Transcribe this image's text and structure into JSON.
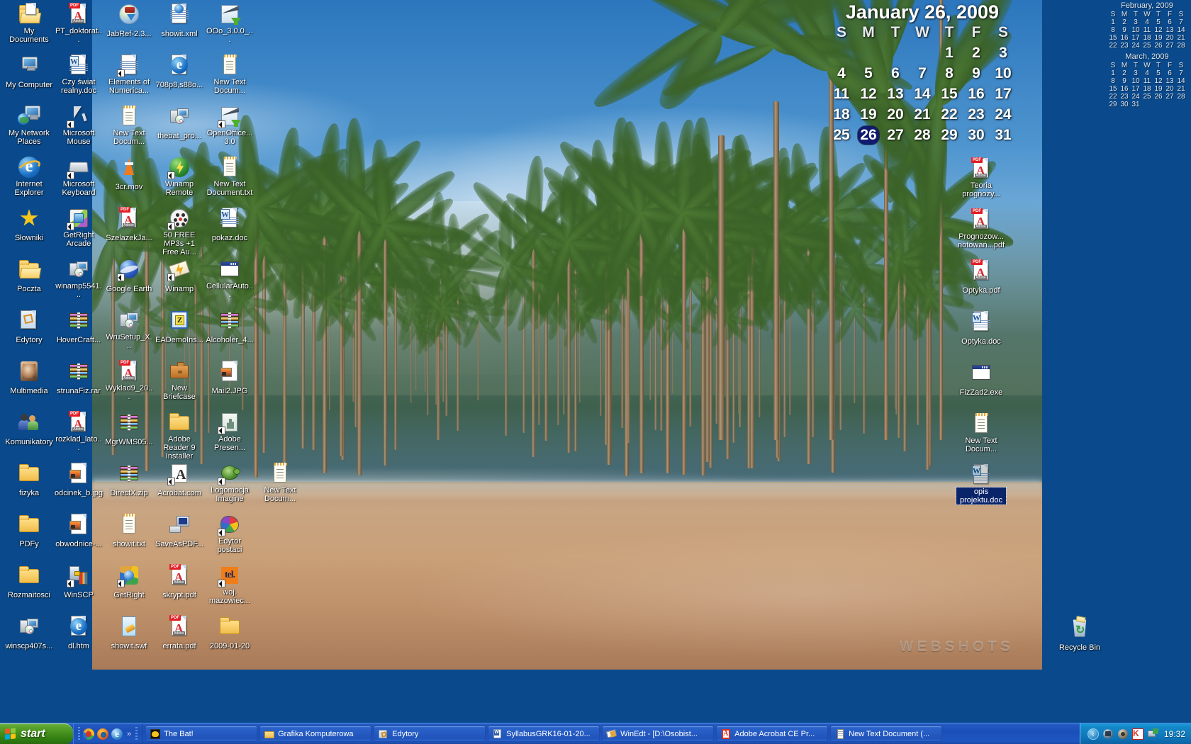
{
  "desktop": {
    "background_color": "#0A4A8C",
    "watermark": "WEBSHOTS",
    "icons_left": [
      {
        "label": "My Documents",
        "art": "mydocs",
        "shortcut": false
      },
      {
        "label": "My Computer",
        "art": "mycomputer",
        "shortcut": false
      },
      {
        "label": "My Network Places",
        "art": "network",
        "shortcut": false
      },
      {
        "label": "Internet Explorer",
        "art": "ie",
        "shortcut": false
      },
      {
        "label": "Słowniki",
        "art": "star",
        "shortcut": false
      },
      {
        "label": "Poczta",
        "art": "folder-open",
        "shortcut": false
      },
      {
        "label": "Edytory",
        "art": "edytory",
        "shortcut": false
      },
      {
        "label": "Multimedia",
        "art": "face",
        "shortcut": false
      },
      {
        "label": "Komunikatory",
        "art": "people",
        "shortcut": false
      },
      {
        "label": "fizyka",
        "art": "folder",
        "shortcut": false
      },
      {
        "label": "PDFy",
        "art": "folder",
        "shortcut": false
      },
      {
        "label": "Rozmaitosci",
        "art": "folder",
        "shortcut": false
      },
      {
        "label": "winscp407s...",
        "art": "camera-cd",
        "shortcut": false
      }
    ],
    "icons_col2": [
      {
        "label": "PT_doktorat...",
        "art": "pdf",
        "shortcut": false
      },
      {
        "label": "Czy świat realny.doc",
        "art": "word",
        "shortcut": false
      },
      {
        "label": "Microsoft Mouse",
        "art": "mouse",
        "shortcut": true
      },
      {
        "label": "Microsoft Keyboard",
        "art": "keyboard",
        "shortcut": true
      },
      {
        "label": "GetRight Arcade",
        "art": "dice",
        "shortcut": true
      },
      {
        "label": "winamp5541...",
        "art": "camera-cd",
        "shortcut": false
      },
      {
        "label": "HoverCraft...",
        "art": "rar",
        "shortcut": false
      },
      {
        "label": "strunaFiz.rar",
        "art": "rar",
        "shortcut": false
      },
      {
        "label": "rozklad_lato...",
        "art": "pdf",
        "shortcut": false
      },
      {
        "label": "odcinek_b.jpg",
        "art": "image",
        "shortcut": false
      },
      {
        "label": "obwodnice-...",
        "art": "image",
        "shortcut": false
      },
      {
        "label": "WinSCP",
        "art": "winscp",
        "shortcut": true
      },
      {
        "label": "dl.htm",
        "art": "ie-doc",
        "shortcut": false
      }
    ],
    "icons_col3": [
      {
        "label": "JabRef-2.3...",
        "art": "jabref",
        "shortcut": false
      },
      {
        "label": "Elements of Numerica...",
        "art": "doc",
        "shortcut": true
      },
      {
        "label": "New Text Docum...",
        "art": "notepad",
        "shortcut": false
      },
      {
        "label": "3cr.mov",
        "art": "vlc",
        "shortcut": false
      },
      {
        "label": "SzelazekJa...",
        "art": "pdf",
        "shortcut": false
      },
      {
        "label": "Google Earth",
        "art": "googleearth",
        "shortcut": true
      },
      {
        "label": "WruSetup_X...",
        "art": "camera-cd",
        "shortcut": false
      },
      {
        "label": "Wyklad9_20...",
        "art": "pdf",
        "shortcut": false
      },
      {
        "label": "MgrWMS05...",
        "art": "rar",
        "shortcut": false
      },
      {
        "label": "DirectX.zip",
        "art": "rar",
        "shortcut": false
      },
      {
        "label": "showit.txt",
        "art": "notepad",
        "shortcut": false
      },
      {
        "label": "GetRight",
        "art": "getright",
        "shortcut": true
      },
      {
        "label": "showit.swf",
        "art": "swf",
        "shortcut": false
      }
    ],
    "icons_col4": [
      {
        "label": "showit.xml",
        "art": "xml",
        "shortcut": false
      },
      {
        "label": "708p8,s88o...",
        "art": "ie-doc",
        "shortcut": false
      },
      {
        "label": "thebat_pro...",
        "art": "camera-cd",
        "shortcut": false
      },
      {
        "label": "Winamp Remote",
        "art": "winamp",
        "shortcut": true
      },
      {
        "label": "50 FREE MP3s +1 Free Au...",
        "art": "mp3disc",
        "shortcut": true
      },
      {
        "label": "Winamp",
        "art": "winamp-lightning",
        "shortcut": true
      },
      {
        "label": "EADemoIns...",
        "art": "eademo",
        "shortcut": false
      },
      {
        "label": "New Briefcase",
        "art": "briefcase",
        "shortcut": false
      },
      {
        "label": "Adobe Reader 9 Installer",
        "art": "folder",
        "shortcut": false
      },
      {
        "label": "Acrobat.com",
        "art": "acrobatcom",
        "shortcut": true
      },
      {
        "label": "SaveAsPDF...",
        "art": "savepdf",
        "shortcut": false
      },
      {
        "label": "skrypt.pdf",
        "art": "pdf",
        "shortcut": false
      },
      {
        "label": "errata.pdf",
        "art": "pdf",
        "shortcut": false
      }
    ],
    "icons_col5": [
      {
        "label": "OOo_3.0.0_...",
        "art": "ooo",
        "shortcut": false
      },
      {
        "label": "New Text Docum...",
        "art": "notepad",
        "shortcut": false
      },
      {
        "label": "OpenOffice... 3.0",
        "art": "ooo-sc",
        "shortcut": true
      },
      {
        "label": "New Text Document.txt",
        "art": "notepad",
        "shortcut": false
      },
      {
        "label": "pokaz.doc",
        "art": "word",
        "shortcut": false
      },
      {
        "label": "CellularAuto...",
        "art": "exe",
        "shortcut": false
      },
      {
        "label": "Alcoholer_4...",
        "art": "rar",
        "shortcut": false
      },
      {
        "label": "Mail2.JPG",
        "art": "image",
        "shortcut": false
      },
      {
        "label": "Adobe Presen...",
        "art": "adobe-pres",
        "shortcut": true
      },
      {
        "label": "Logomocja Imagine",
        "art": "turtle",
        "shortcut": true
      },
      {
        "label": "Edytor postaci",
        "art": "palette",
        "shortcut": true
      },
      {
        "label": "woj. mazowiec...",
        "art": "tel",
        "shortcut": true
      },
      {
        "label": "2009-01-20",
        "art": "folder",
        "shortcut": false
      }
    ],
    "icons_col6": [
      {
        "label": "New Text Docum...",
        "art": "notepad",
        "shortcut": false
      }
    ],
    "icons_right": [
      {
        "label": "Teoria prognozy...",
        "art": "pdf",
        "shortcut": false,
        "selected": false
      },
      {
        "label": "Prognozow... notowań...pdf",
        "art": "pdf",
        "shortcut": false,
        "selected": false
      },
      {
        "label": "Optyka.pdf",
        "art": "pdf",
        "shortcut": false,
        "selected": false
      },
      {
        "label": "Optyka.doc",
        "art": "word",
        "shortcut": false,
        "selected": false
      },
      {
        "label": "FizZad2.exe",
        "art": "exe",
        "shortcut": false,
        "selected": false
      },
      {
        "label": "New Text Docum...",
        "art": "notepad",
        "shortcut": false,
        "selected": false
      },
      {
        "label": "opis projektu.doc",
        "art": "word",
        "shortcut": false,
        "selected": true
      }
    ],
    "recycle_bin": {
      "label": "Recycle Bin",
      "art": "recycle"
    }
  },
  "calendar": {
    "title": "January 26, 2009",
    "weekday_headers": [
      "S",
      "M",
      "T",
      "W",
      "T",
      "F",
      "S"
    ],
    "today": 26,
    "weeks": [
      [
        "",
        "",
        "",
        "",
        "1",
        "2",
        "3"
      ],
      [
        "4",
        "5",
        "6",
        "7",
        "8",
        "9",
        "10"
      ],
      [
        "11",
        "12",
        "13",
        "14",
        "15",
        "16",
        "17"
      ],
      [
        "18",
        "19",
        "20",
        "21",
        "22",
        "23",
        "24"
      ],
      [
        "25",
        "26",
        "27",
        "28",
        "29",
        "30",
        "31"
      ]
    ],
    "today_highlight_color": "#101a6e"
  },
  "minicalendars": [
    {
      "title": "February, 2009",
      "weekday_headers": [
        "S",
        "M",
        "T",
        "W",
        "T",
        "F",
        "S"
      ],
      "weeks": [
        [
          "1",
          "2",
          "3",
          "4",
          "5",
          "6",
          "7"
        ],
        [
          "8",
          "9",
          "10",
          "11",
          "12",
          "13",
          "14"
        ],
        [
          "15",
          "16",
          "17",
          "18",
          "19",
          "20",
          "21"
        ],
        [
          "22",
          "23",
          "24",
          "25",
          "26",
          "27",
          "28"
        ]
      ]
    },
    {
      "title": "March, 2009",
      "weekday_headers": [
        "S",
        "M",
        "T",
        "W",
        "T",
        "F",
        "S"
      ],
      "weeks": [
        [
          "1",
          "2",
          "3",
          "4",
          "5",
          "6",
          "7"
        ],
        [
          "8",
          "9",
          "10",
          "11",
          "12",
          "13",
          "14"
        ],
        [
          "15",
          "16",
          "17",
          "18",
          "19",
          "20",
          "21"
        ],
        [
          "22",
          "23",
          "24",
          "25",
          "26",
          "27",
          "28"
        ],
        [
          "29",
          "30",
          "31",
          "",
          "",
          "",
          ""
        ]
      ]
    }
  ],
  "taskbar": {
    "start_label": "start",
    "quicklaunch": [
      {
        "name": "getright-icon"
      },
      {
        "name": "firefox-icon"
      },
      {
        "name": "internet-explorer-icon"
      }
    ],
    "quicklaunch_more": "»",
    "tasks": [
      {
        "label": "The Bat!",
        "icon": "thebat-icon"
      },
      {
        "label": "Grafika Komputerowa",
        "icon": "folder-icon"
      },
      {
        "label": "Edytory",
        "icon": "folder-shortcut-icon"
      },
      {
        "label": "SyllabusGRK16-01-20...",
        "icon": "word-icon"
      },
      {
        "label": "WinEdt - [D:\\Osobist...",
        "icon": "winedt-icon"
      },
      {
        "label": "Adobe Acrobat CE Pr...",
        "icon": "acrobat-icon"
      },
      {
        "label": "New Text Document (...",
        "icon": "notepad-icon"
      }
    ],
    "tray": {
      "chevron": "‹",
      "icons": [
        {
          "name": "safely-remove-hardware-icon"
        },
        {
          "name": "speaker-volume-icon"
        },
        {
          "name": "kaspersky-icon"
        },
        {
          "name": "network-connection-icon"
        }
      ],
      "clock": "19:32"
    }
  }
}
